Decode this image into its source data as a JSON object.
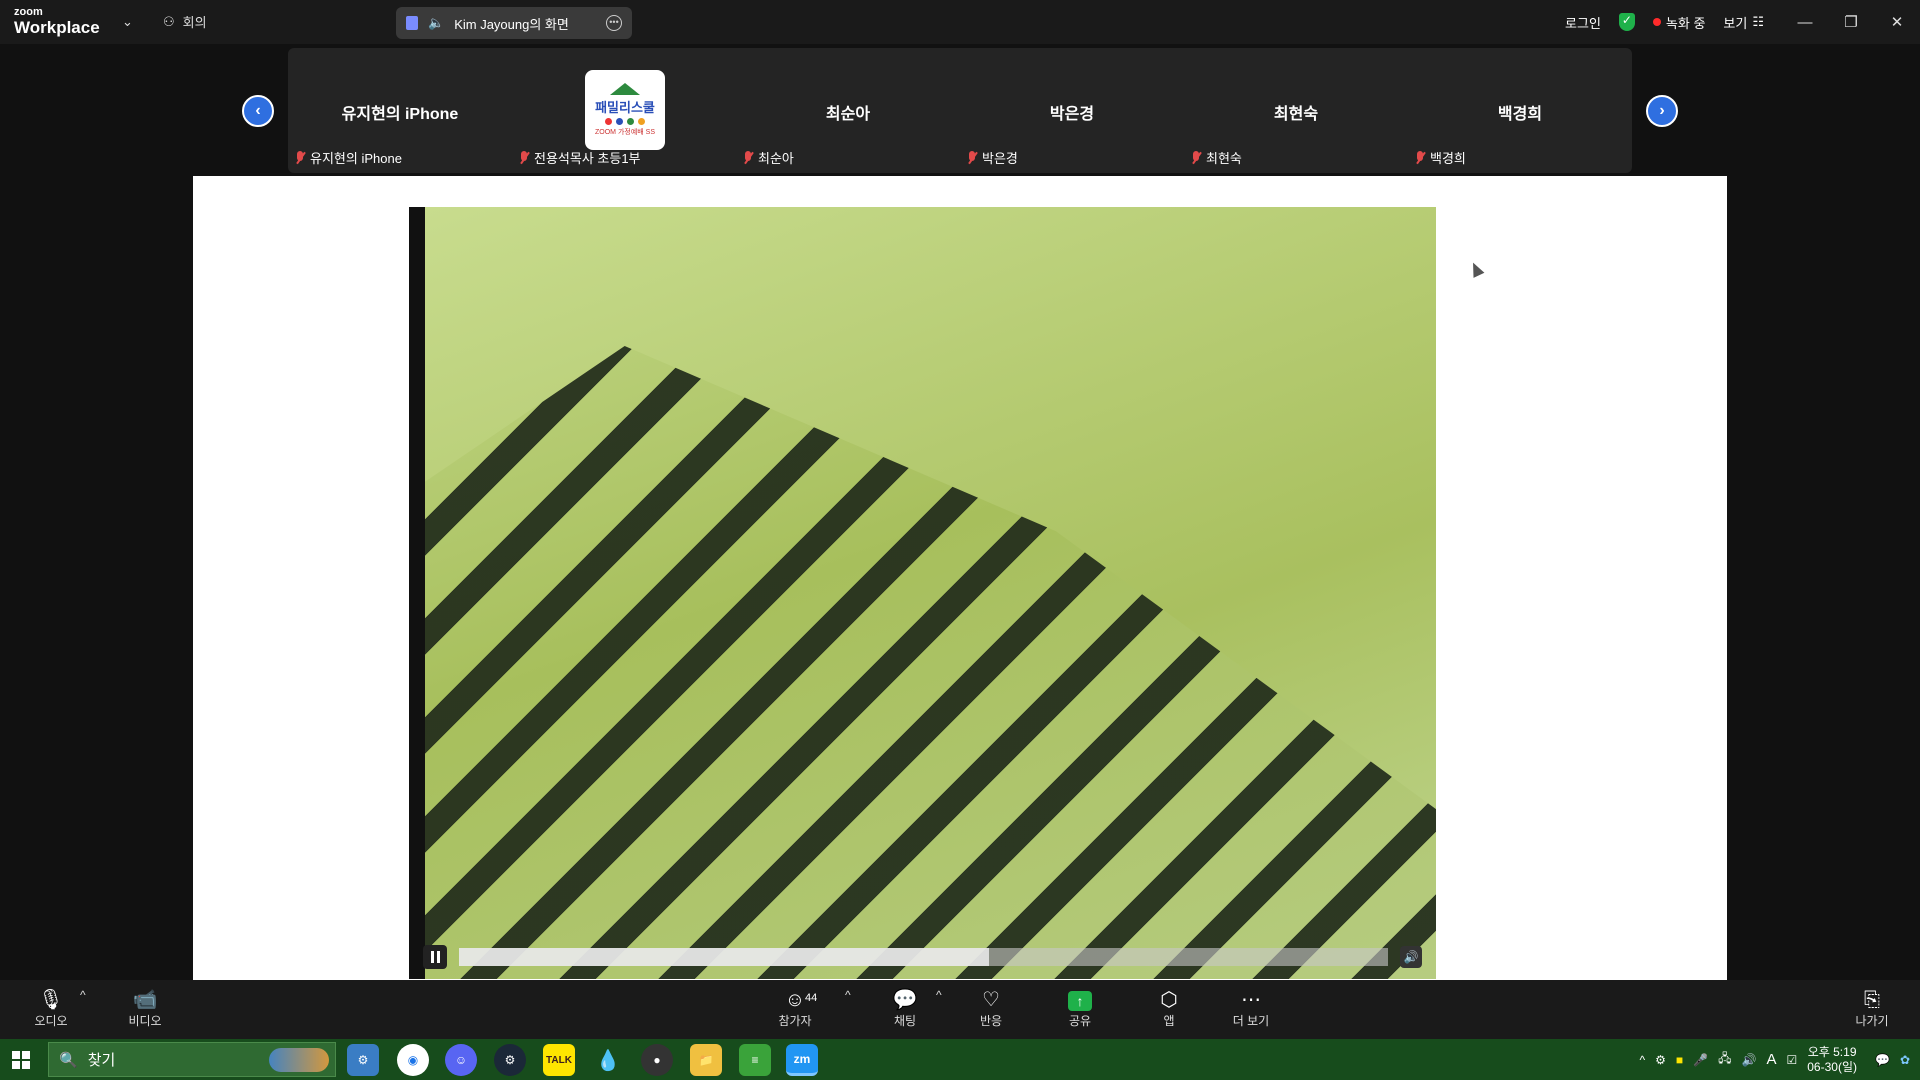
{
  "topbar": {
    "brand_small": "zoom",
    "brand_big": "Workplace",
    "meeting_label": "회의",
    "share_title": "Kim Jayoung의 화면",
    "login": "로그인",
    "recording": "녹화 중",
    "view": "보기"
  },
  "participants": {
    "tiles": [
      {
        "big": "유지현의 iPhone",
        "label": "유지현의 iPhone"
      },
      {
        "big": "",
        "label": "전용석목사 초등1부"
      },
      {
        "big": "최순아",
        "label": "최순아"
      },
      {
        "big": "박은경",
        "label": "박은경"
      },
      {
        "big": "최현숙",
        "label": "최현숙"
      },
      {
        "big": "백경희",
        "label": "백경희"
      }
    ],
    "logo_title": "패밀리스쿨",
    "logo_sub": "ZOOM 가정예배 SS"
  },
  "video": {
    "progress": 0.57,
    "colors": {
      "light": "#c4d98a",
      "dark": "#1e2819"
    }
  },
  "toolbar": {
    "audio": "오디오",
    "video": "비디오",
    "participants": "참가자",
    "participant_count": "44",
    "chat": "채팅",
    "reactions": "반응",
    "share": "공유",
    "apps": "앱",
    "more": "더 보기",
    "leave": "나가기"
  },
  "taskbar": {
    "search_placeholder": "찾기",
    "apps": [
      "settings-app",
      "chrome",
      "discord",
      "steam",
      "kakaotalk",
      "drop-app",
      "github",
      "file-explorer",
      "notes-app",
      "zoom"
    ],
    "time": "오후 5:19",
    "date": "06-30(일)",
    "ime": "A",
    "zoom_label": "zm",
    "talk_label": "TALK"
  }
}
